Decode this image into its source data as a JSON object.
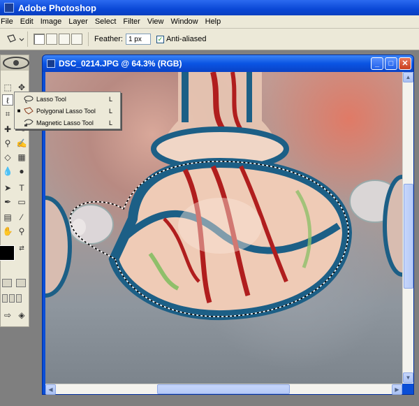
{
  "app": {
    "title": "Adobe Photoshop"
  },
  "menu": [
    "File",
    "Edit",
    "Image",
    "Layer",
    "Select",
    "Filter",
    "View",
    "Window",
    "Help"
  ],
  "options": {
    "feather_label": "Feather:",
    "feather_value": "1 px",
    "antialias_label": "Anti-aliased",
    "antialias_checked": true
  },
  "flyout": {
    "items": [
      {
        "label": "Lasso Tool",
        "key": "L",
        "selected": false
      },
      {
        "label": "Polygonal Lasso Tool",
        "key": "L",
        "selected": true
      },
      {
        "label": "Magnetic Lasso Tool",
        "key": "L",
        "selected": false
      }
    ]
  },
  "document": {
    "title": "DSC_0214.JPG @ 64.3% (RGB)",
    "minimize": "_",
    "restore": "□",
    "close": "✕"
  },
  "colors": {
    "titlebar": "#0a47d6",
    "chrome": "#ece9d8",
    "glass_red": "#b01e1e",
    "glass_blue": "#1c5f86",
    "foreground": "#000000",
    "background": "#ffffff"
  }
}
